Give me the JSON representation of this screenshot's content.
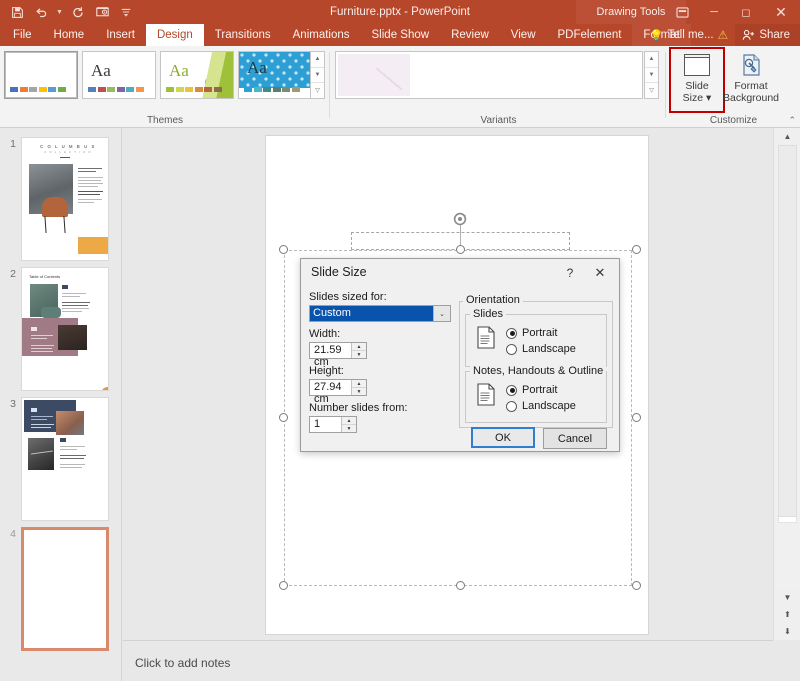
{
  "titlebar": {
    "document_title": "Furniture.pptx - PowerPoint",
    "contextual_tools": "Drawing Tools",
    "quick_access": [
      {
        "name": "save-icon",
        "glyph": "ὋE"
      },
      {
        "name": "undo-icon",
        "glyph": "↶"
      },
      {
        "name": "redo-icon",
        "glyph": "↻"
      },
      {
        "name": "start-presentation-icon",
        "glyph": "▶"
      },
      {
        "name": "customize-qat-icon",
        "glyph": "≡"
      }
    ],
    "window_buttons": [
      {
        "name": "ribbon-display-options",
        "glyph": "▣"
      },
      {
        "name": "minimize",
        "glyph": "─"
      },
      {
        "name": "restore",
        "glyph": "❐"
      },
      {
        "name": "close",
        "glyph": "✕"
      }
    ]
  },
  "tabs": [
    {
      "label": "File",
      "active": false
    },
    {
      "label": "Home",
      "active": false
    },
    {
      "label": "Insert",
      "active": false
    },
    {
      "label": "Design",
      "active": true
    },
    {
      "label": "Transitions",
      "active": false
    },
    {
      "label": "Animations",
      "active": false
    },
    {
      "label": "Slide Show",
      "active": false
    },
    {
      "label": "Review",
      "active": false
    },
    {
      "label": "View",
      "active": false
    },
    {
      "label": "PDFelement",
      "active": false
    },
    {
      "label": "Format",
      "active": false
    }
  ],
  "tellme": {
    "label": "Tell me...",
    "share_label": "Share"
  },
  "ribbon": {
    "groups": [
      {
        "name": "themes",
        "label": "Themes"
      },
      {
        "name": "variants",
        "label": "Variants"
      },
      {
        "name": "customize",
        "label": "Customize"
      }
    ],
    "customize_buttons": [
      {
        "name": "slide-size-button",
        "line1": "Slide",
        "line2": "Size",
        "highlighted": true
      },
      {
        "name": "format-background-button",
        "line1": "Format",
        "line2": "Background",
        "highlighted": false
      }
    ],
    "collapse_label": "⌃"
  },
  "thumbnails": [
    {
      "number": "1",
      "selected": false
    },
    {
      "number": "2",
      "selected": false
    },
    {
      "number": "3",
      "selected": false
    },
    {
      "number": "4",
      "selected": true
    }
  ],
  "slide_text": {
    "slide1_title": "C O L U M B U S",
    "slide1_subtitle": "C O L L E C T I O N",
    "slide2_heading": "Table of Contents"
  },
  "notes": {
    "placeholder": "Click to add notes"
  },
  "dialog": {
    "title": "Slide Size",
    "help_glyph": "?",
    "close_glyph": "✕",
    "slides_sized_for": {
      "label": "Slides sized for:",
      "value": "Custom",
      "arrow": "⌄"
    },
    "width": {
      "label": "Width:",
      "value": "21.59 cm"
    },
    "height": {
      "label": "Height:",
      "value": "27.94 cm"
    },
    "number_from": {
      "label": "Number slides from:",
      "value": "1"
    },
    "orientation": {
      "label": "Orientation",
      "slides": {
        "label": "Slides",
        "options": [
          {
            "label": "Portrait",
            "selected": true
          },
          {
            "label": "Landscape",
            "selected": false
          }
        ]
      },
      "notes": {
        "label": "Notes, Handouts & Outline",
        "options": [
          {
            "label": "Portrait",
            "selected": true
          },
          {
            "label": "Landscape",
            "selected": false
          }
        ]
      }
    },
    "buttons": [
      {
        "name": "ok-button",
        "label": "OK",
        "default": true
      },
      {
        "name": "cancel-button",
        "label": "Cancel",
        "default": false
      }
    ]
  },
  "scrollbar": {
    "up": "▲",
    "down": "▼",
    "prev_slide": "⬆",
    "next_slide": "⬇"
  },
  "colors": {
    "ribbon_red": "#b7472a",
    "highlight_red": "#c00000",
    "selection_blue": "#0a53ad",
    "thumb_select": "#d98a6a"
  }
}
